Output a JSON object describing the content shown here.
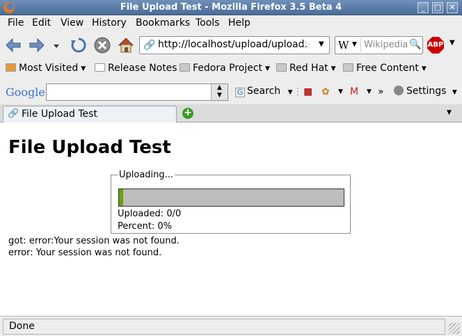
{
  "window": {
    "title": "File Upload Test - Mozilla Firefox 3.5 Beta 4",
    "minimize": "_",
    "maximize": "□",
    "close": "✕"
  },
  "menu": [
    "File",
    "Edit",
    "View",
    "History",
    "Bookmarks",
    "Tools",
    "Help"
  ],
  "nav": {
    "url": "http://localhost/upload/upload.",
    "search_engine_icon": "W",
    "search_placeholder": "Wikipedia",
    "adblock_label": "ABP",
    "icons": [
      "back-icon",
      "forward-icon",
      "reload-icon",
      "stop-icon",
      "home-icon"
    ]
  },
  "bookmarks": [
    {
      "label": "Most Visited",
      "dropdown": true
    },
    {
      "label": "Release Notes",
      "dropdown": false
    },
    {
      "label": "Fedora Project",
      "dropdown": true
    },
    {
      "label": "Red Hat",
      "dropdown": true
    },
    {
      "label": "Free Content",
      "dropdown": true
    }
  ],
  "google": {
    "logo": "Google",
    "search_value": "",
    "search_label": "Search",
    "settings_label": "Settings",
    "overflow": "»"
  },
  "tabs": [
    {
      "label": "File Upload Test"
    }
  ],
  "page": {
    "heading": "File Upload Test",
    "fieldset_legend": "Uploading...",
    "progress_fraction": 0.02,
    "uploaded_text": "Uploaded: 0/0",
    "percent_text": "Percent: 0%",
    "message1": "got: error:Your session was not found.",
    "message2": "error: Your session was not found."
  },
  "status": {
    "text": "Done"
  },
  "colors": {
    "titlebar": "#4a6c98",
    "progress_fill": "#6aa10e",
    "progress_track": "#bdbdbd",
    "abp": "#cc0000"
  }
}
